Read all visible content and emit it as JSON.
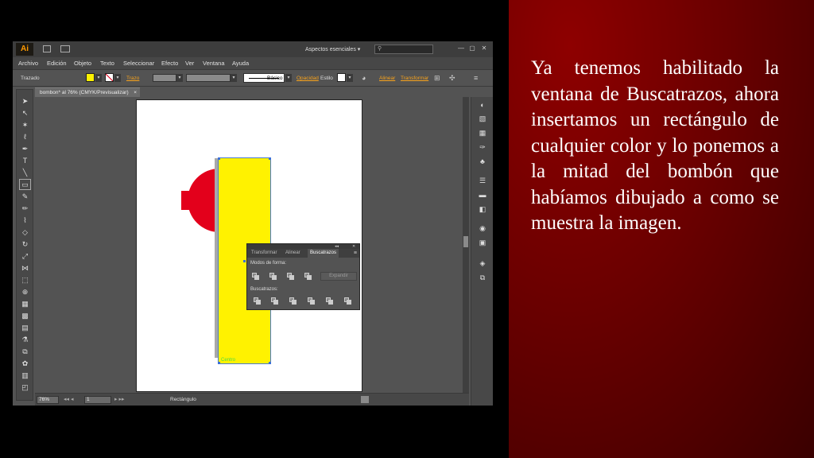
{
  "slide": {
    "text": "Ya tenemos habilitado la ventana de Buscatrazos, ahora insertamos un rectángulo de cualquier color y lo ponemos a la mitad del bombón que habíamos dibujado a como se muestra la imagen."
  },
  "app": {
    "logo": "Ai",
    "workspace": "Aspectos esenciales",
    "workspace_arrow": "▾",
    "search_icon": "search-icon",
    "search_glyph": "⚲",
    "window_buttons": [
      "—",
      "▢",
      "✕"
    ]
  },
  "menu": [
    "Archivo",
    "Edición",
    "Objeto",
    "Texto",
    "Seleccionar",
    "Efecto",
    "Ver",
    "Ventana",
    "Ayuda"
  ],
  "control_bar": {
    "mode": "Trazado",
    "stroke_label": "Trazo",
    "brush_value": "Básico",
    "opacity_label": "Opacidad",
    "style_label": "Estilo",
    "align_label": "Alinear",
    "transform_label": "Transformar",
    "fill_color": "#fff200",
    "stroke_color": "#ffffff"
  },
  "document": {
    "tab_title": "bombon* al 76% (CMYK/Previsualizar)",
    "tab_close": "×",
    "shape_label": "Centro"
  },
  "status_bar": {
    "zoom": "76%",
    "artboard_number": "1",
    "selection": "Rectángulo",
    "nav_prev": "◂◂  ◂",
    "nav_next": "▸  ▸▸"
  },
  "pathfinder_panel": {
    "tabs": [
      "Transformar",
      "Alinear",
      "Buscatrazos"
    ],
    "active_tab": "Buscatrazos",
    "menu_icon": "≡",
    "collapse": "◂◂",
    "close": "✕",
    "shape_modes_label": "Modos de forma:",
    "expand_button": "Expandir",
    "pathfinders_label": "Buscatrazos:"
  },
  "colors": {
    "red": "#e3001b",
    "yellow": "#fff200",
    "slide_red": "#8e0000"
  }
}
